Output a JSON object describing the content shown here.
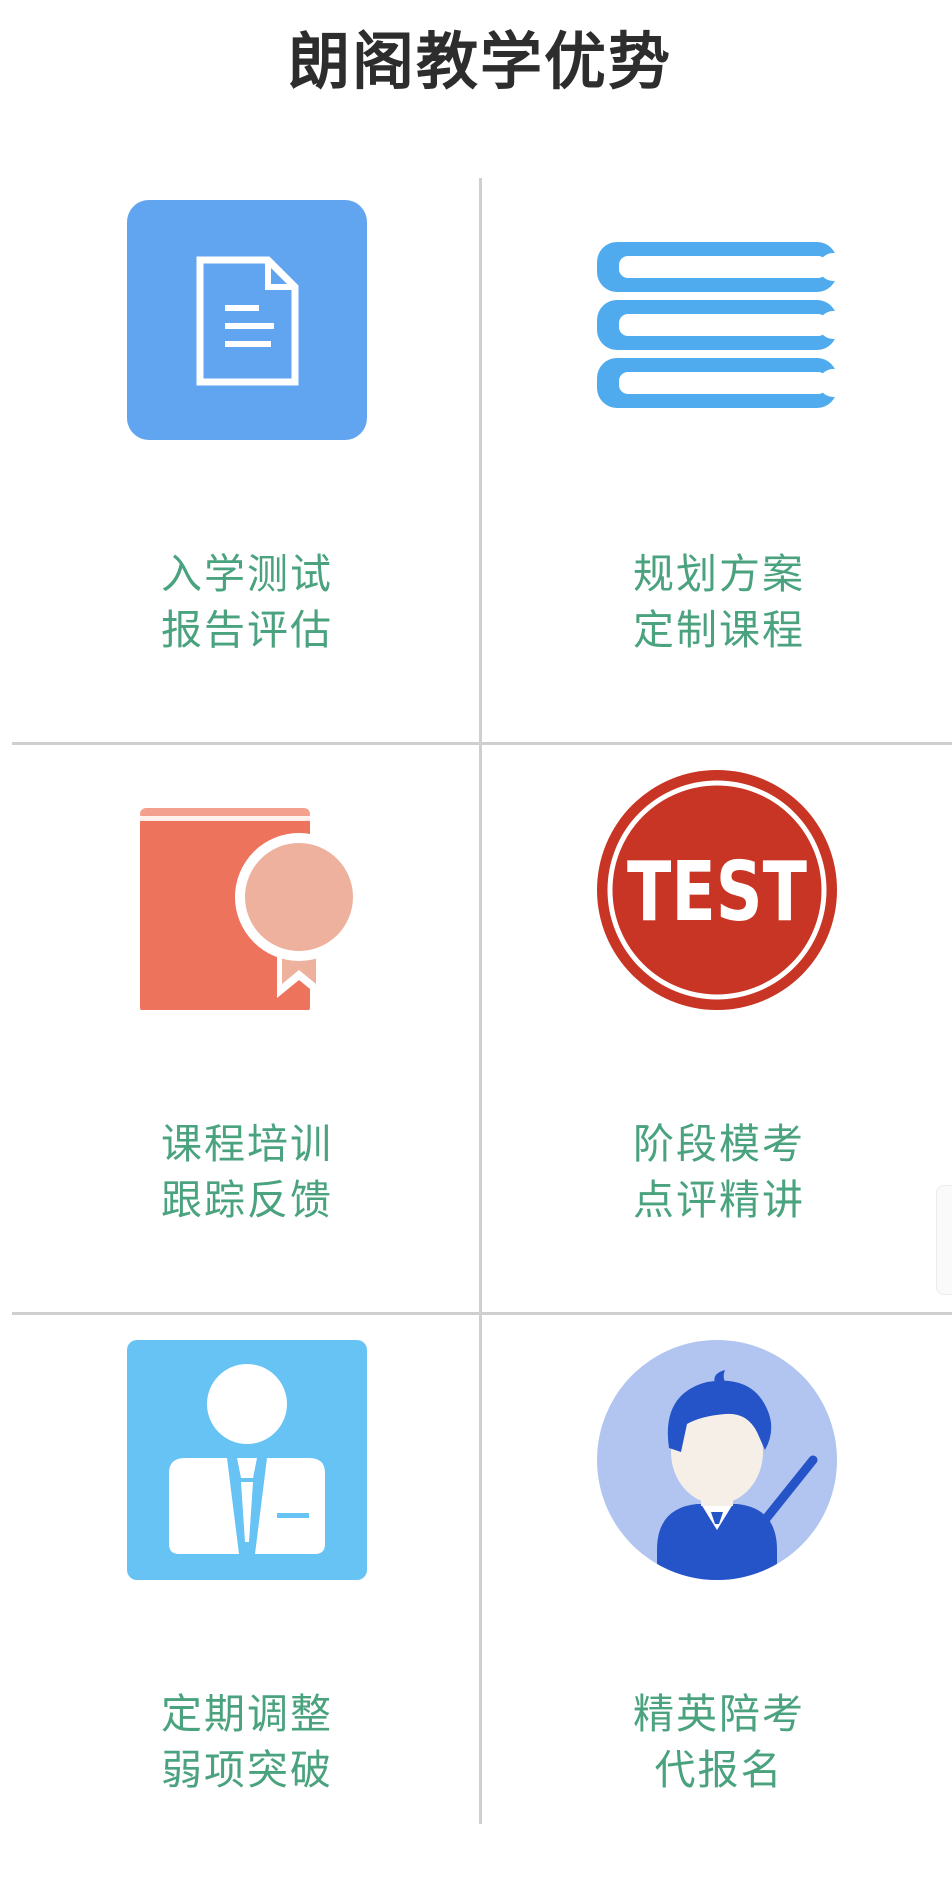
{
  "page": {
    "title": "朗阁教学优势"
  },
  "colors": {
    "label_text": "#4aa37e",
    "title_text": "#2d2d2d",
    "grid_line": "#cfcfcf"
  },
  "advantages": [
    {
      "icon": "document-icon",
      "line1": "入学测试",
      "line2": "报告评估"
    },
    {
      "icon": "book-stack-icon",
      "line1": "规划方案",
      "line2": "定制课程"
    },
    {
      "icon": "certificate-book-icon",
      "line1": "课程培训",
      "line2": "跟踪反馈"
    },
    {
      "icon": "test-badge-icon",
      "line1": "阶段模考",
      "line2": "点评精讲",
      "badge_text": "TEST"
    },
    {
      "icon": "businessman-icon",
      "line1": "定期调整",
      "line2": "弱项突破"
    },
    {
      "icon": "teacher-icon",
      "line1": "精英陪考",
      "line2": "代报名"
    }
  ]
}
